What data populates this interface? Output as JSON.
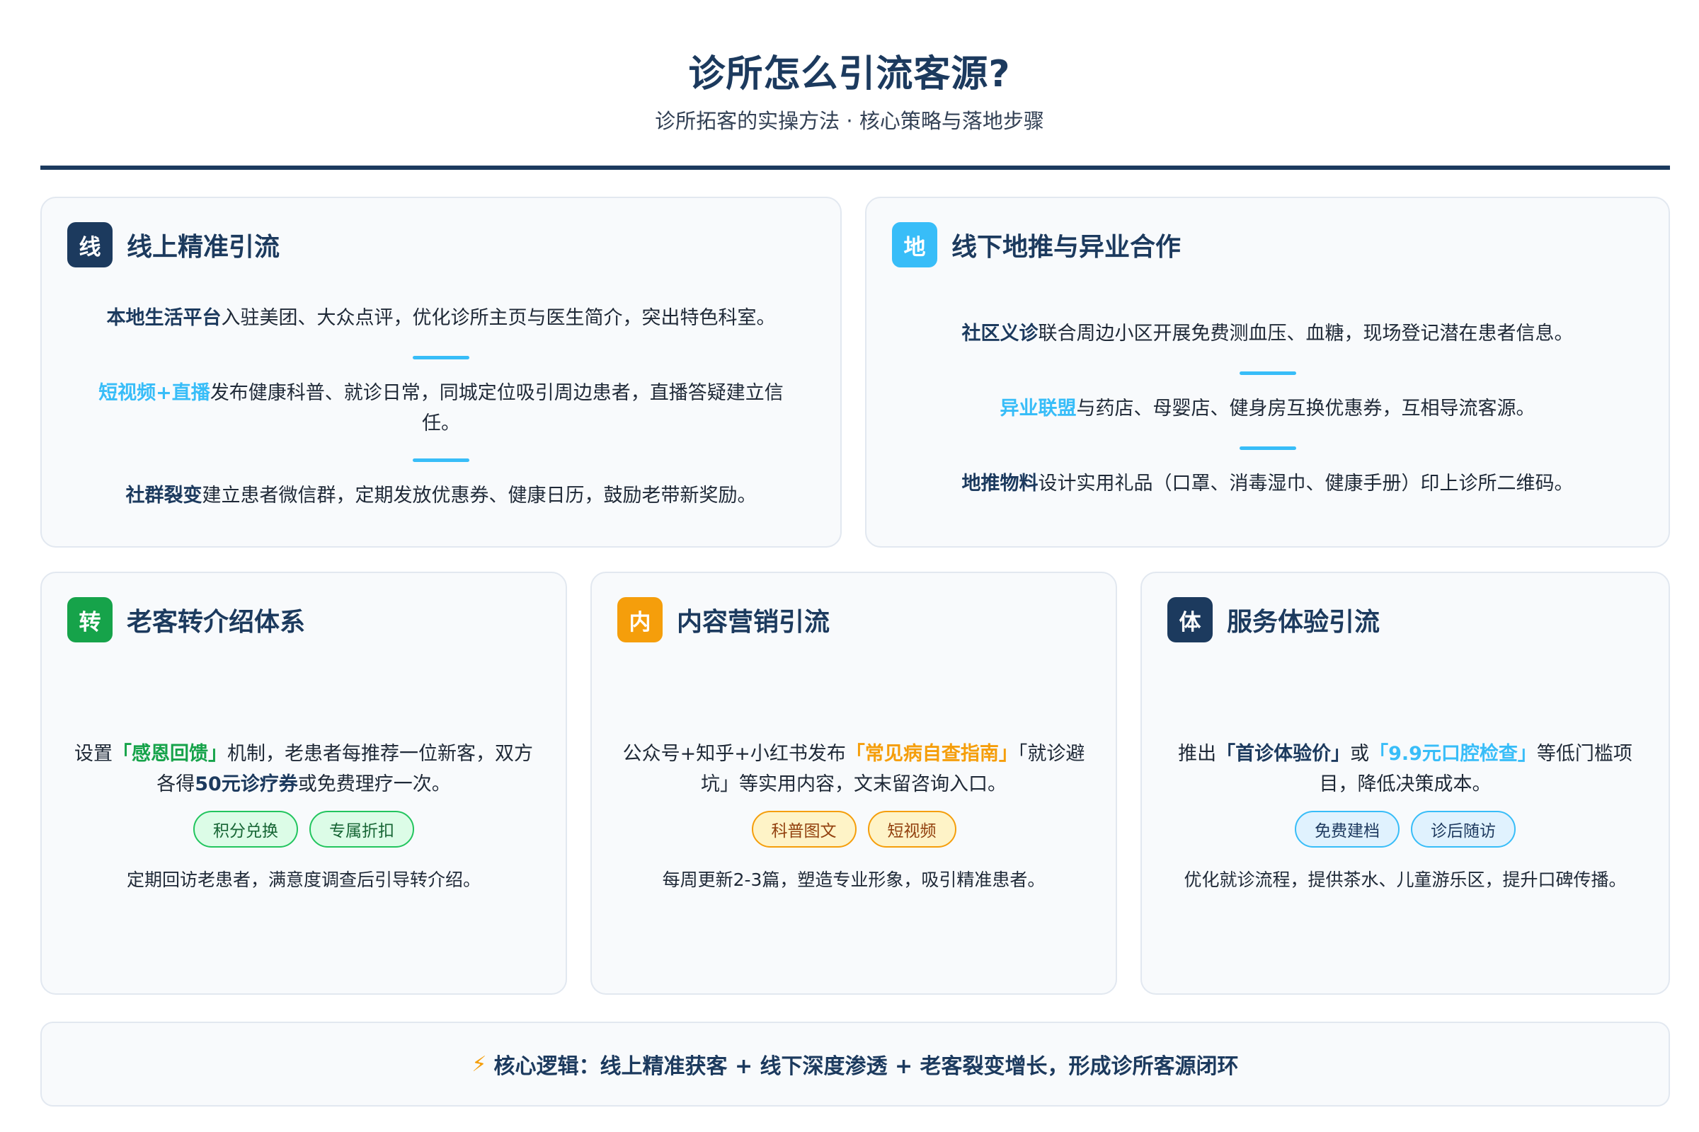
{
  "header": {
    "title": "诊所怎么引流客源?",
    "subtitle": "诊所拓客的实操方法 · 核心策略与落地步骤"
  },
  "colors": {
    "navy": "#1c3a5e",
    "sky": "#38bdf8",
    "green": "#16a34a",
    "orange": "#f59e0b"
  },
  "online": {
    "badge": "线",
    "title": "线上精准引流",
    "items": [
      {
        "key": "本地生活平台",
        "text": "入驻美团、大众点评，优化诊所主页与医生简介，突出特色科室。"
      },
      {
        "key": "短视频+直播",
        "text": "发布健康科普、就诊日常，同城定位吸引周边患者，直播答疑建立信任。"
      },
      {
        "key": "社群裂变",
        "text": "建立患者微信群，定期发放优惠券、健康日历，鼓励老带新奖励。"
      }
    ]
  },
  "offline": {
    "badge": "地",
    "title": "线下地推与异业合作",
    "items": [
      {
        "key": "社区义诊",
        "text": "联合周边小区开展免费测血压、血糖，现场登记潜在患者信息。"
      },
      {
        "key": "异业联盟",
        "text": "与药店、母婴店、健身房互换优惠券，互相导流客源。"
      },
      {
        "key": "地推物料",
        "text": "设计实用礼品（口罩、消毒湿巾、健康手册）印上诊所二维码。"
      }
    ]
  },
  "referral": {
    "badge": "转",
    "title": "老客转介绍体系",
    "p1": "设置",
    "hl1": "「感恩回馈」",
    "p2": "机制，老患者每推荐一位新客，双方各得",
    "hl2": "50元诊疗券",
    "p3": "或免费理疗一次。",
    "tags": [
      "积分兑换",
      "专属折扣"
    ],
    "note": "定期回访老患者，满意度调查后引导转介绍。"
  },
  "content": {
    "badge": "内",
    "title": "内容营销引流",
    "p1": "公众号+知乎+小红书发布",
    "hl1": "「常见病自查指南」",
    "p2": "「就诊避坑」等实用内容，文末留咨询入口。",
    "tags": [
      "科普图文",
      "短视频"
    ],
    "note": "每周更新2-3篇，塑造专业形象，吸引精准患者。"
  },
  "service": {
    "badge": "体",
    "title": "服务体验引流",
    "p1": "推出",
    "hl1": "「首诊体验价」",
    "p2": "或",
    "hl2": "「9.9元口腔检查」",
    "p3": "等低门槛项目，降低决策成本。",
    "tags": [
      "免费建档",
      "诊后随访"
    ],
    "note": "优化就诊流程，提供茶水、儿童游乐区，提升口碑传播。"
  },
  "footer": {
    "icon": "lightning-icon",
    "text": "核心逻辑：线上精准获客 + 线下深度渗透 + 老客裂变增长，形成诊所客源闭环"
  }
}
